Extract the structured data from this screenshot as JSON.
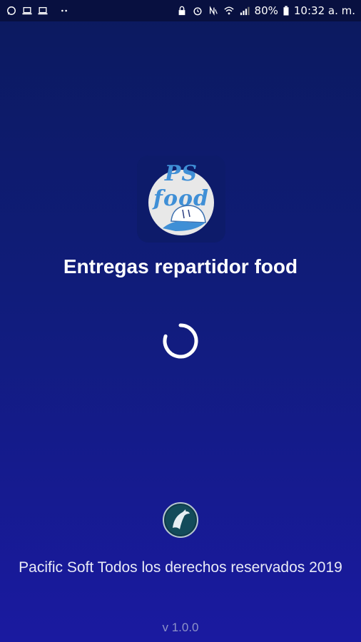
{
  "status_bar": {
    "battery": "80%",
    "time": "10:32 a. m.",
    "left_icons": [
      "whatsapp-icon",
      "laptop-icon",
      "laptop-icon",
      "more-dots-icon"
    ],
    "right_icons": [
      "lock-icon",
      "alarm-icon",
      "nfc-icon",
      "wifi-icon",
      "signal-icon",
      "battery-icon"
    ]
  },
  "logo": {
    "brand": "PS food",
    "icon": "delivery-cap-icon"
  },
  "app": {
    "title": "Entregas repartidor food"
  },
  "loading": {
    "icon": "loading-spinner-icon"
  },
  "footer": {
    "company_icon": "dolphin-logo-icon",
    "copyright": "Pacific Soft Todos los derechos reservados 2019",
    "version": "v 1.0.0"
  },
  "colors": {
    "background_top": "#0b1a5e",
    "background_bottom": "#1a1aa0",
    "brand_blue": "#3f8fd6",
    "text_white": "#ffffff"
  }
}
